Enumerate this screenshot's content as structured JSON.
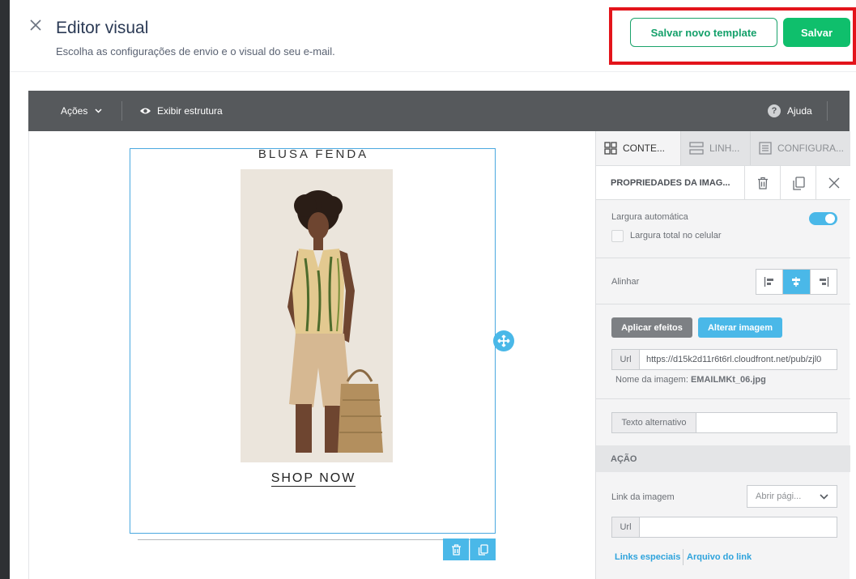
{
  "header": {
    "title": "Editor visual",
    "subtitle": "Escolha as configurações de envio e o visual do seu e-mail.",
    "save_template_label": "Salvar novo template",
    "save_label": "Salvar",
    "close_icon": "close-icon"
  },
  "toolbar": {
    "actions_label": "Ações",
    "show_structure_label": "Exibir estrutura",
    "help_label": "Ajuda",
    "help_glyph": "?"
  },
  "canvas": {
    "product_title": "BLUSA FENDA",
    "cta_text": "SHOP NOW"
  },
  "panel": {
    "tabs": [
      {
        "label": "CONTE...",
        "icon": "grid-icon"
      },
      {
        "label": "LINH...",
        "icon": "rows-icon"
      },
      {
        "label": "CONFIGURA...",
        "icon": "document-icon"
      }
    ],
    "properties_title": "PROPRIEDADES DA IMAG...",
    "auto_width_label": "Largura automática",
    "auto_width_on": true,
    "full_width_mobile_label": "Largura total no celular",
    "full_width_mobile_checked": false,
    "align_label": "Alinhar",
    "align_selected": "center",
    "apply_effects_label": "Aplicar efeitos",
    "change_image_label": "Alterar imagem",
    "url_prefix": "Url",
    "image_url": "https://d15k2d11r6t6rl.cloudfront.net/pub/zjl0",
    "image_name_label": "Nome da imagem:",
    "image_name_value": "EMAILMKt_06.jpg",
    "alt_text_label": "Texto alternativo",
    "alt_text_value": "",
    "action_section": "AÇÃO",
    "image_link_label": "Link da imagem",
    "image_link_select": "Abrir pági...",
    "link_url_prefix": "Url",
    "link_url_value": "",
    "special_links_label": "Links especiais",
    "link_file_label": "Arquivo do link"
  },
  "colors": {
    "accent_green": "#0fbf6c",
    "accent_blue": "#4ab8e8",
    "highlight_red": "#e3141b",
    "toolbar_gray": "#56595c"
  }
}
